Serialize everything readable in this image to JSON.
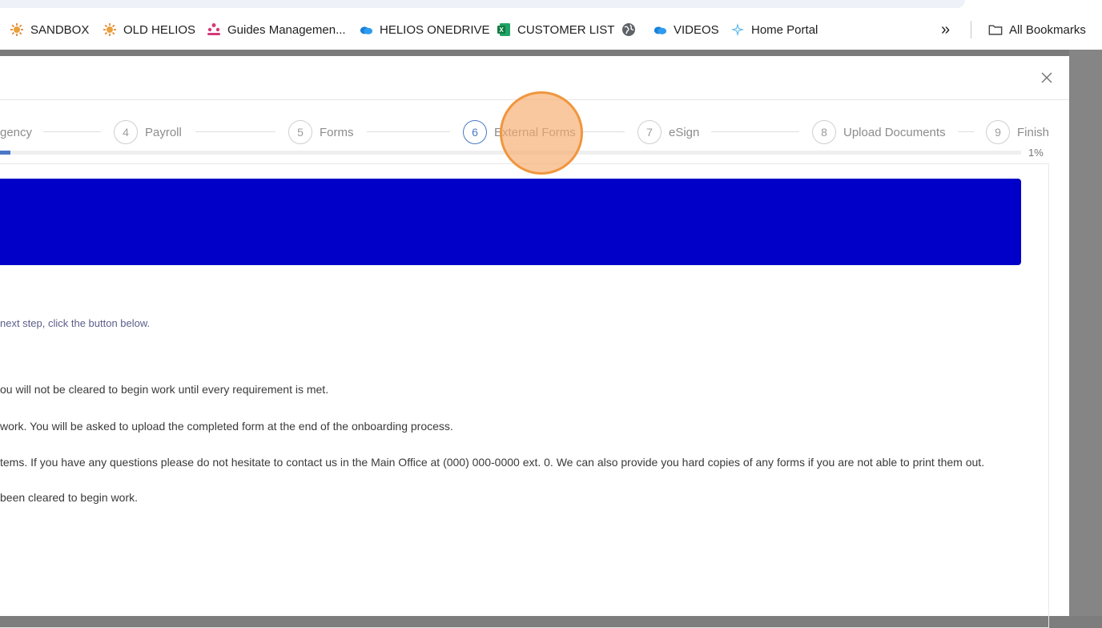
{
  "bookmarks": [
    {
      "label": "SANDBOX",
      "icon": "sun-icon"
    },
    {
      "label": "OLD HELIOS",
      "icon": "sun-icon"
    },
    {
      "label": "Guides Managemen...",
      "icon": "people-icon"
    },
    {
      "label": "HELIOS ONEDRIVE",
      "icon": "cloud-icon"
    },
    {
      "label": "CUSTOMER LIST",
      "icon": "excel-icon"
    },
    {
      "label": "",
      "icon": "globe-icon"
    },
    {
      "label": "VIDEOS",
      "icon": "cloud-icon"
    },
    {
      "label": "Home Portal",
      "icon": "portal-icon"
    }
  ],
  "bookmarks_overflow": "»",
  "all_bookmarks": "All Bookmarks",
  "modal": {
    "close": "×",
    "steps": [
      {
        "number": "",
        "label": "gency"
      },
      {
        "number": "4",
        "label": "Payroll"
      },
      {
        "number": "5",
        "label": "Forms"
      },
      {
        "number": "6",
        "label": "External Forms",
        "active": true
      },
      {
        "number": "7",
        "label": "eSign"
      },
      {
        "number": "8",
        "label": "Upload Documents"
      },
      {
        "number": "9",
        "label": "Finish"
      }
    ],
    "progress": {
      "percent": 1,
      "text": "1%"
    },
    "instruction": "next step, click the button below.",
    "paragraphs": [
      "ou will not be cleared to begin work until every requirement is met.",
      "work. You will be asked to upload the completed form at the end of the onboarding process.",
      "tems. If you have any questions please do not hesitate to contact us in the Main Office at (000) 000-0000 ext. 0. We can also provide you hard copies of any forms if you are not able to print them out.",
      "been cleared to begin work."
    ]
  },
  "colors": {
    "banner": "#0000c8",
    "active_step": "#4a78c8",
    "highlight": "#f0963e"
  }
}
